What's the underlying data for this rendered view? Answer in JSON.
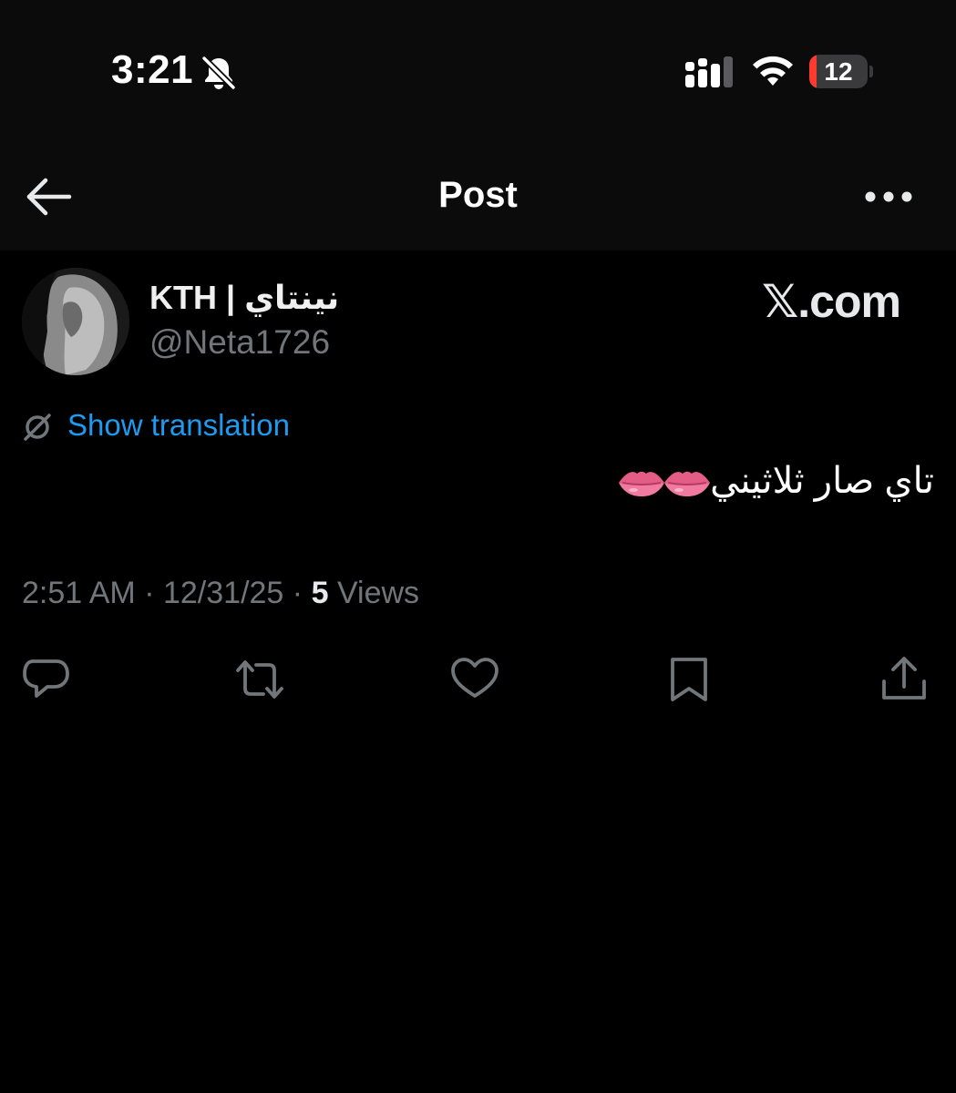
{
  "status_bar": {
    "time": "3:21",
    "battery_percent": "12",
    "battery_level": 0.12,
    "icons": [
      "bell-slash-icon",
      "signal-icon",
      "wifi-icon",
      "battery-icon"
    ]
  },
  "header": {
    "title": "Post",
    "back_icon": "arrow-left-icon",
    "more_icon": "ellipsis-icon"
  },
  "post": {
    "display_name": "KTH | نينتاي",
    "handle": "@Neta1726",
    "watermark": "𝕏.com",
    "show_translation_label": "Show translation",
    "text": "تاي صار ثلاثيني",
    "emoji": [
      "lips-icon",
      "lips-icon"
    ],
    "time": "2:51 AM",
    "separator": "·",
    "date": "12/31/25",
    "views_count": "5",
    "views_label": "Views"
  },
  "actions": [
    "reply-icon",
    "repost-icon",
    "like-icon",
    "bookmark-icon",
    "share-icon"
  ],
  "colors": {
    "background": "#000000",
    "header_background": "#0b0b0b",
    "link": "#1d9bf0",
    "secondary_text": "#71767b",
    "battery_low": "#ff3b30"
  }
}
